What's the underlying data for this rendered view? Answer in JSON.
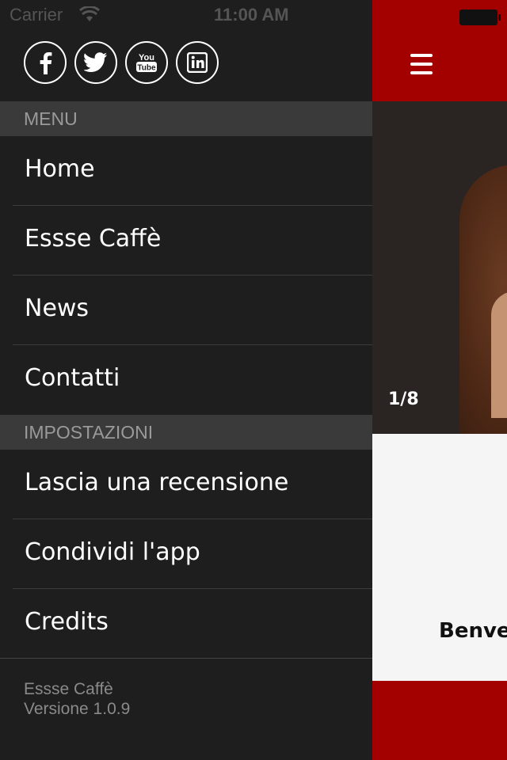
{
  "status_bar": {
    "carrier": "Carrier",
    "time": "11:00 AM"
  },
  "social_icons": [
    "facebook-icon",
    "twitter-icon",
    "youtube-icon",
    "linkedin-icon"
  ],
  "menu": {
    "header": "MENU",
    "items": [
      "Home",
      "Essse Caffè",
      "News",
      "Contatti"
    ]
  },
  "settings": {
    "header": "IMPOSTAZIONI",
    "items": [
      "Lascia una recensione",
      "Condividi l'app",
      "Credits"
    ]
  },
  "footer": {
    "app_name": "Essse Caffè",
    "version": "Versione 1.0.9"
  },
  "main": {
    "slider_counter": "1/8",
    "welcome_text": "Benve"
  },
  "colors": {
    "brand_red": "#a30000",
    "drawer_bg": "#1e1e1f",
    "section_bg": "#3a3a3b"
  }
}
